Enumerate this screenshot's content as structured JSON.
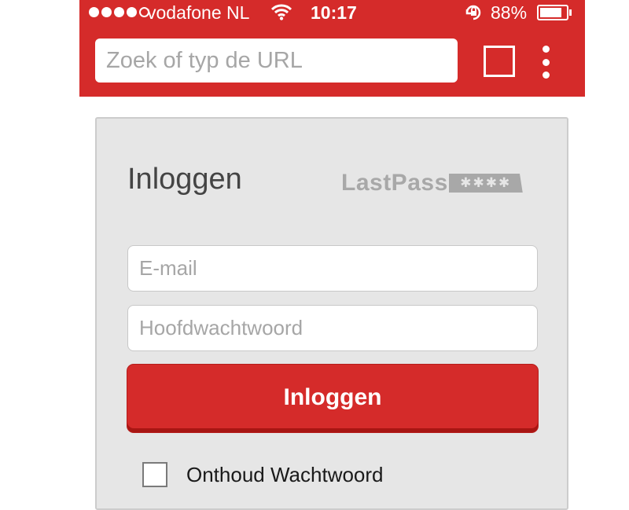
{
  "status_bar": {
    "carrier": "vodafone NL",
    "time": "10:17",
    "battery_percent": "88%",
    "battery_level": 0.88,
    "signal_bars_filled": 4,
    "signal_bars_total": 5,
    "icons": [
      "wifi-icon",
      "rotation-lock-icon",
      "battery-icon"
    ]
  },
  "toolbar": {
    "url_placeholder": "Zoek of typ de URL",
    "url_value": "",
    "icons": [
      "tabs-icon",
      "menu-dots-icon"
    ]
  },
  "login": {
    "title": "Inloggen",
    "logo_text": "LastPass",
    "logo_stars": "✱✱✱✱",
    "email_placeholder": "E-mail",
    "password_placeholder": "Hoofdwachtwoord",
    "submit_label": "Inloggen",
    "remember_label": "Onthoud Wachtwoord",
    "remember_checked": false
  },
  "colors": {
    "accent": "#d52b2a",
    "card_bg": "#e6e6e6",
    "logo_gray": "#a8a8a8"
  }
}
